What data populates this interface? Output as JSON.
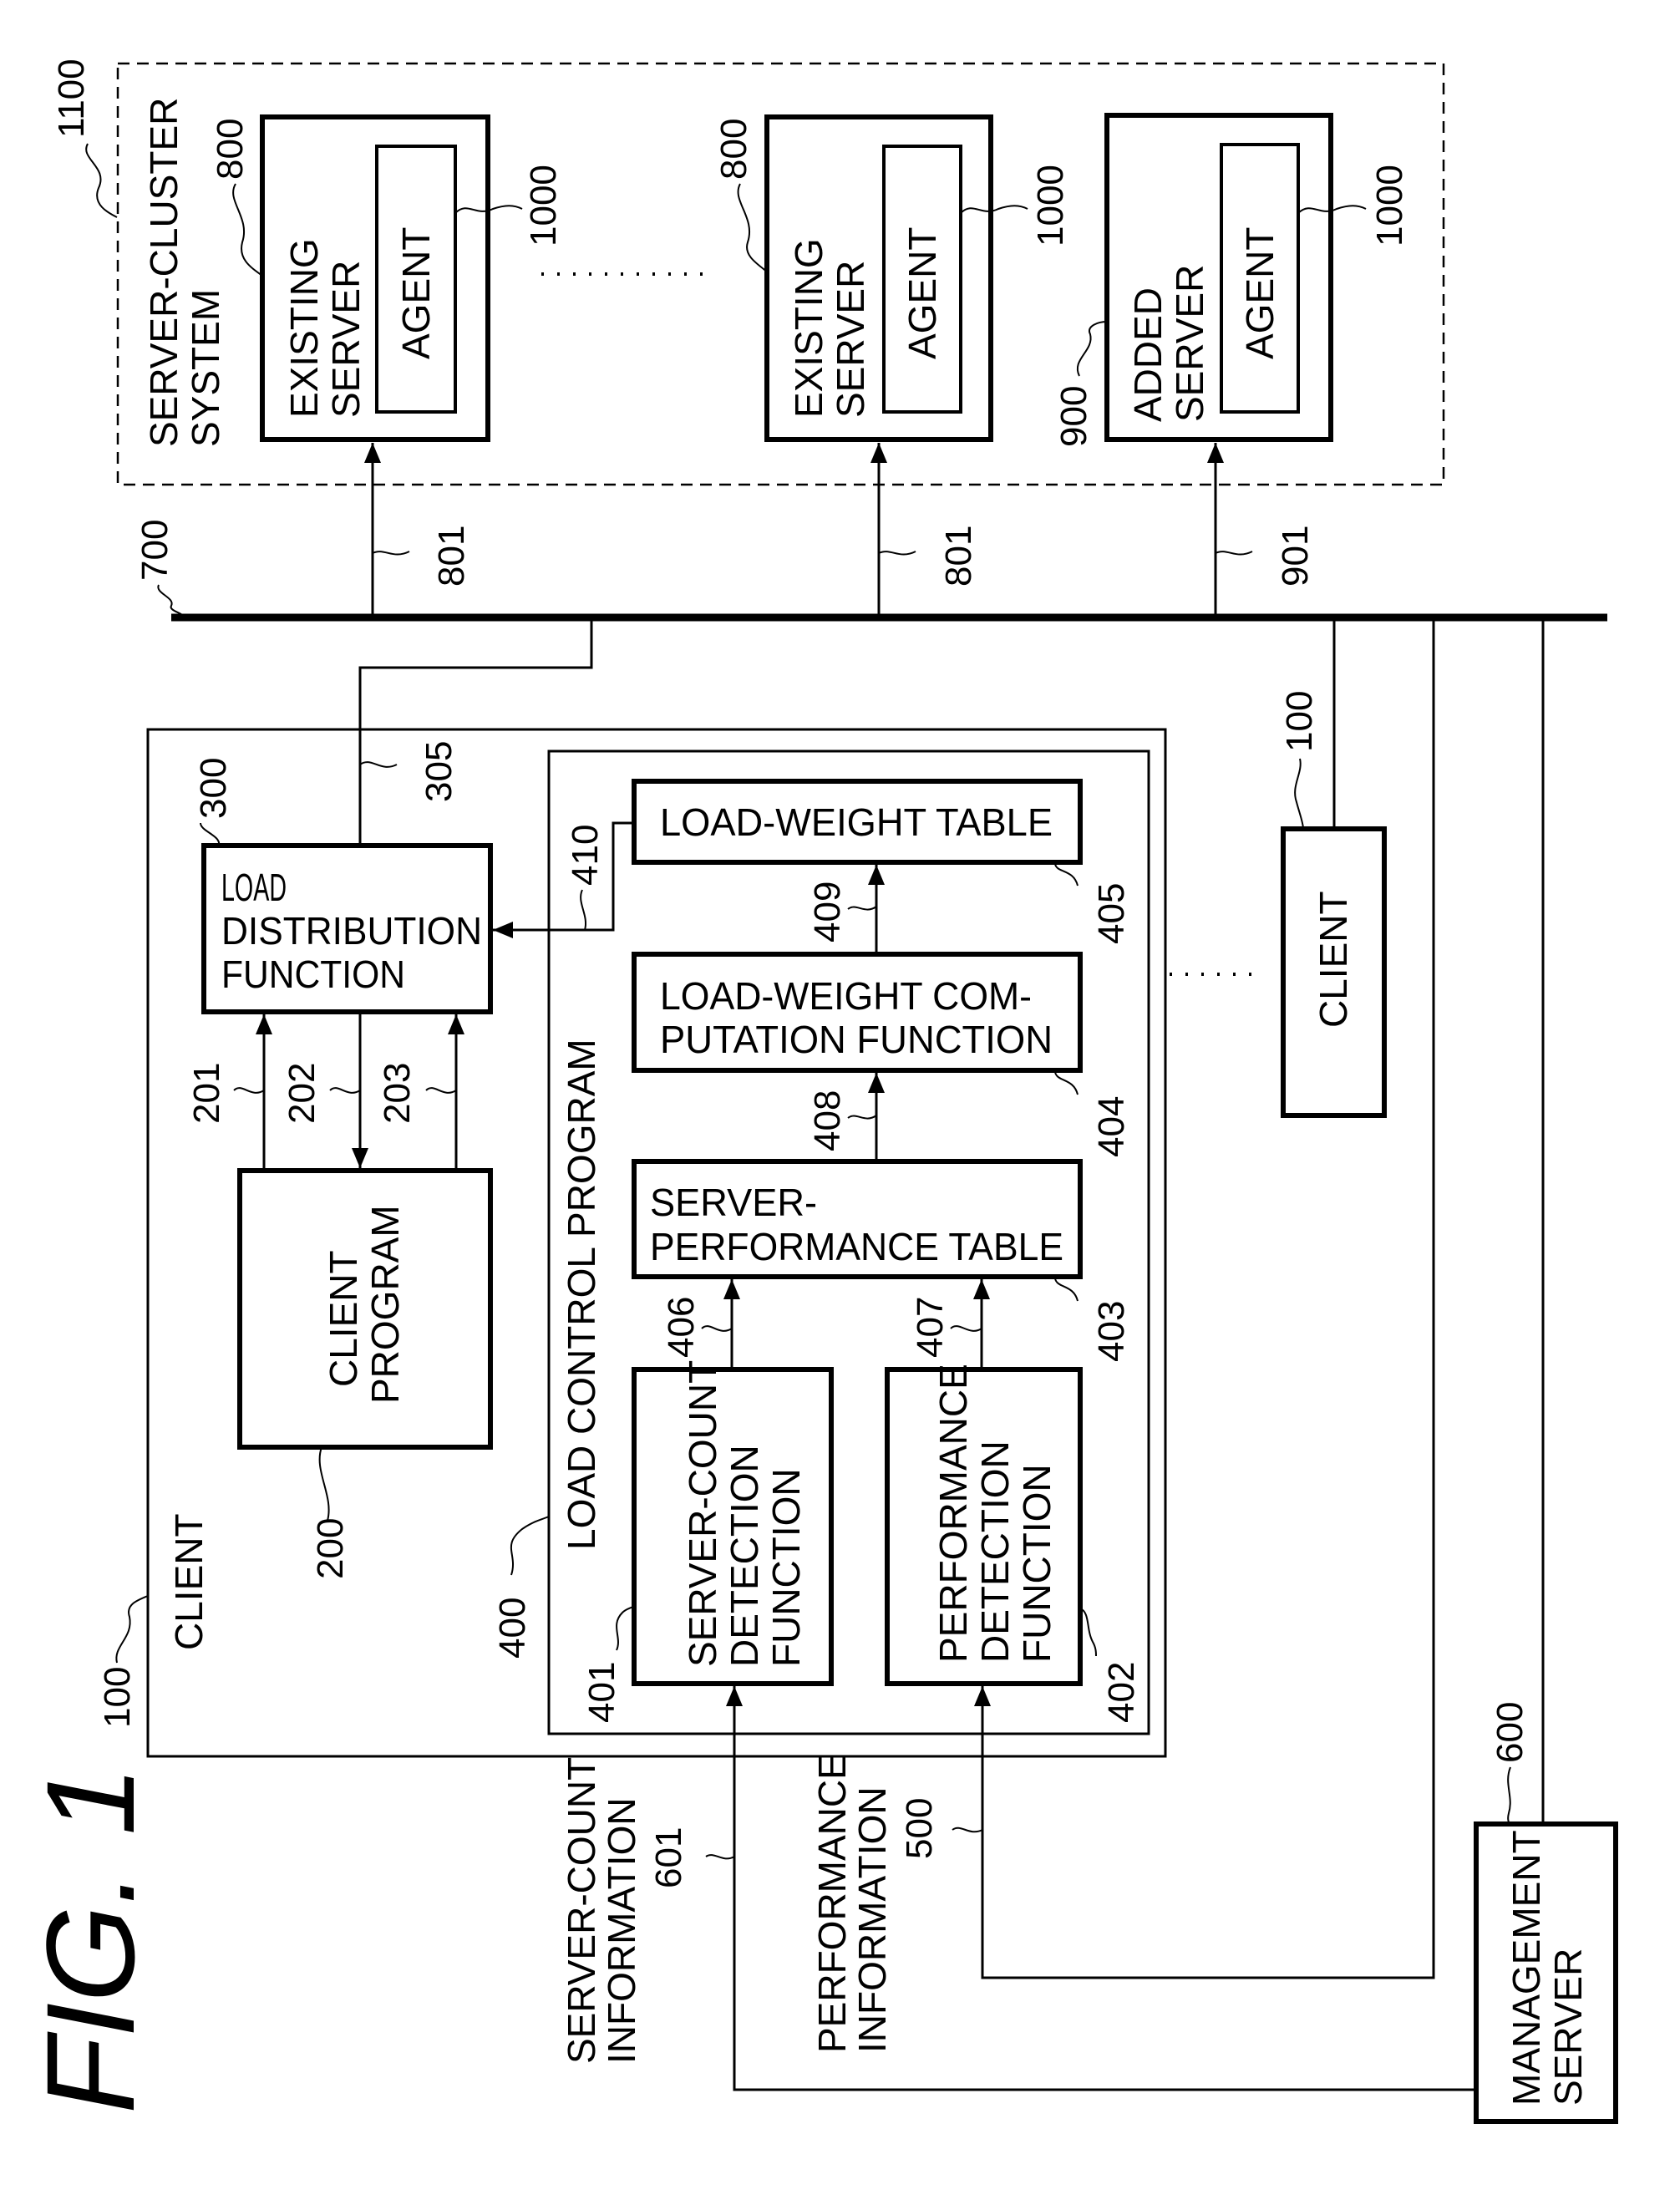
{
  "figure": {
    "title": "FIG. 1"
  },
  "server_cluster": {
    "ref": "1100",
    "label_lines": [
      "SERVER-CLUSTER",
      "SYSTEM"
    ],
    "servers": [
      {
        "ref": "800",
        "label_lines": [
          "EXISTING",
          "SERVER"
        ],
        "agent_label": "AGENT",
        "agent_ref": "1000",
        "link_ref": "801"
      },
      {
        "ref": "800",
        "label_lines": [
          "EXISTING",
          "SERVER"
        ],
        "agent_label": "AGENT",
        "agent_ref": "1000",
        "link_ref": "801"
      },
      {
        "ref": "900",
        "label_lines": [
          "ADDED",
          "SERVER"
        ],
        "agent_label": "AGENT",
        "agent_ref": "1000",
        "link_ref": "901"
      }
    ],
    "ellipsis": "........"
  },
  "network": {
    "ref": "700"
  },
  "client": {
    "ref": "100",
    "label": "CLIENT",
    "link_ref": "305",
    "load_distribution": {
      "ref": "300",
      "label_lines": [
        "LOAD",
        "DISTRIBUTION",
        "FUNCTION"
      ]
    },
    "client_program": {
      "ref": "200",
      "label_lines": [
        "CLIENT",
        "PROGRAM"
      ],
      "arrow_refs": [
        "201",
        "202",
        "203"
      ]
    },
    "load_control_program": {
      "ref": "400",
      "label": "LOAD CONTROL PROGRAM",
      "load_weight_table": {
        "ref": "405",
        "label": "LOAD-WEIGHT TABLE",
        "out_ref": "410"
      },
      "load_weight_computation": {
        "ref": "404",
        "label_lines": [
          "LOAD-WEIGHT COM-",
          "PUTATION FUNCTION"
        ],
        "out_ref": "409"
      },
      "server_performance_table": {
        "ref": "403",
        "label_lines": [
          "SERVER-",
          "PERFORMANCE TABLE"
        ],
        "out_ref": "408"
      },
      "server_count_detection": {
        "ref": "401",
        "label_lines": [
          "SERVER-COUNT",
          "DETECTION",
          "FUNCTION"
        ],
        "out_ref": "406"
      },
      "performance_detection": {
        "ref": "402",
        "label_lines": [
          "PERFORMANCE",
          "DETECTION",
          "FUNCTION"
        ],
        "out_ref": "407"
      }
    }
  },
  "other_client": {
    "ref": "100",
    "label": "CLIENT",
    "ellipsis": "....."
  },
  "management_server": {
    "ref": "600",
    "label_lines": [
      "MANAGEMENT",
      "SERVER"
    ]
  },
  "flows": {
    "server_count_info": {
      "label_lines": [
        "SERVER-COUNT",
        "INFORMATION"
      ],
      "ref": "601"
    },
    "performance_info": {
      "label_lines": [
        "PERFORMANCE",
        "INFORMATION"
      ],
      "ref": "500"
    }
  }
}
